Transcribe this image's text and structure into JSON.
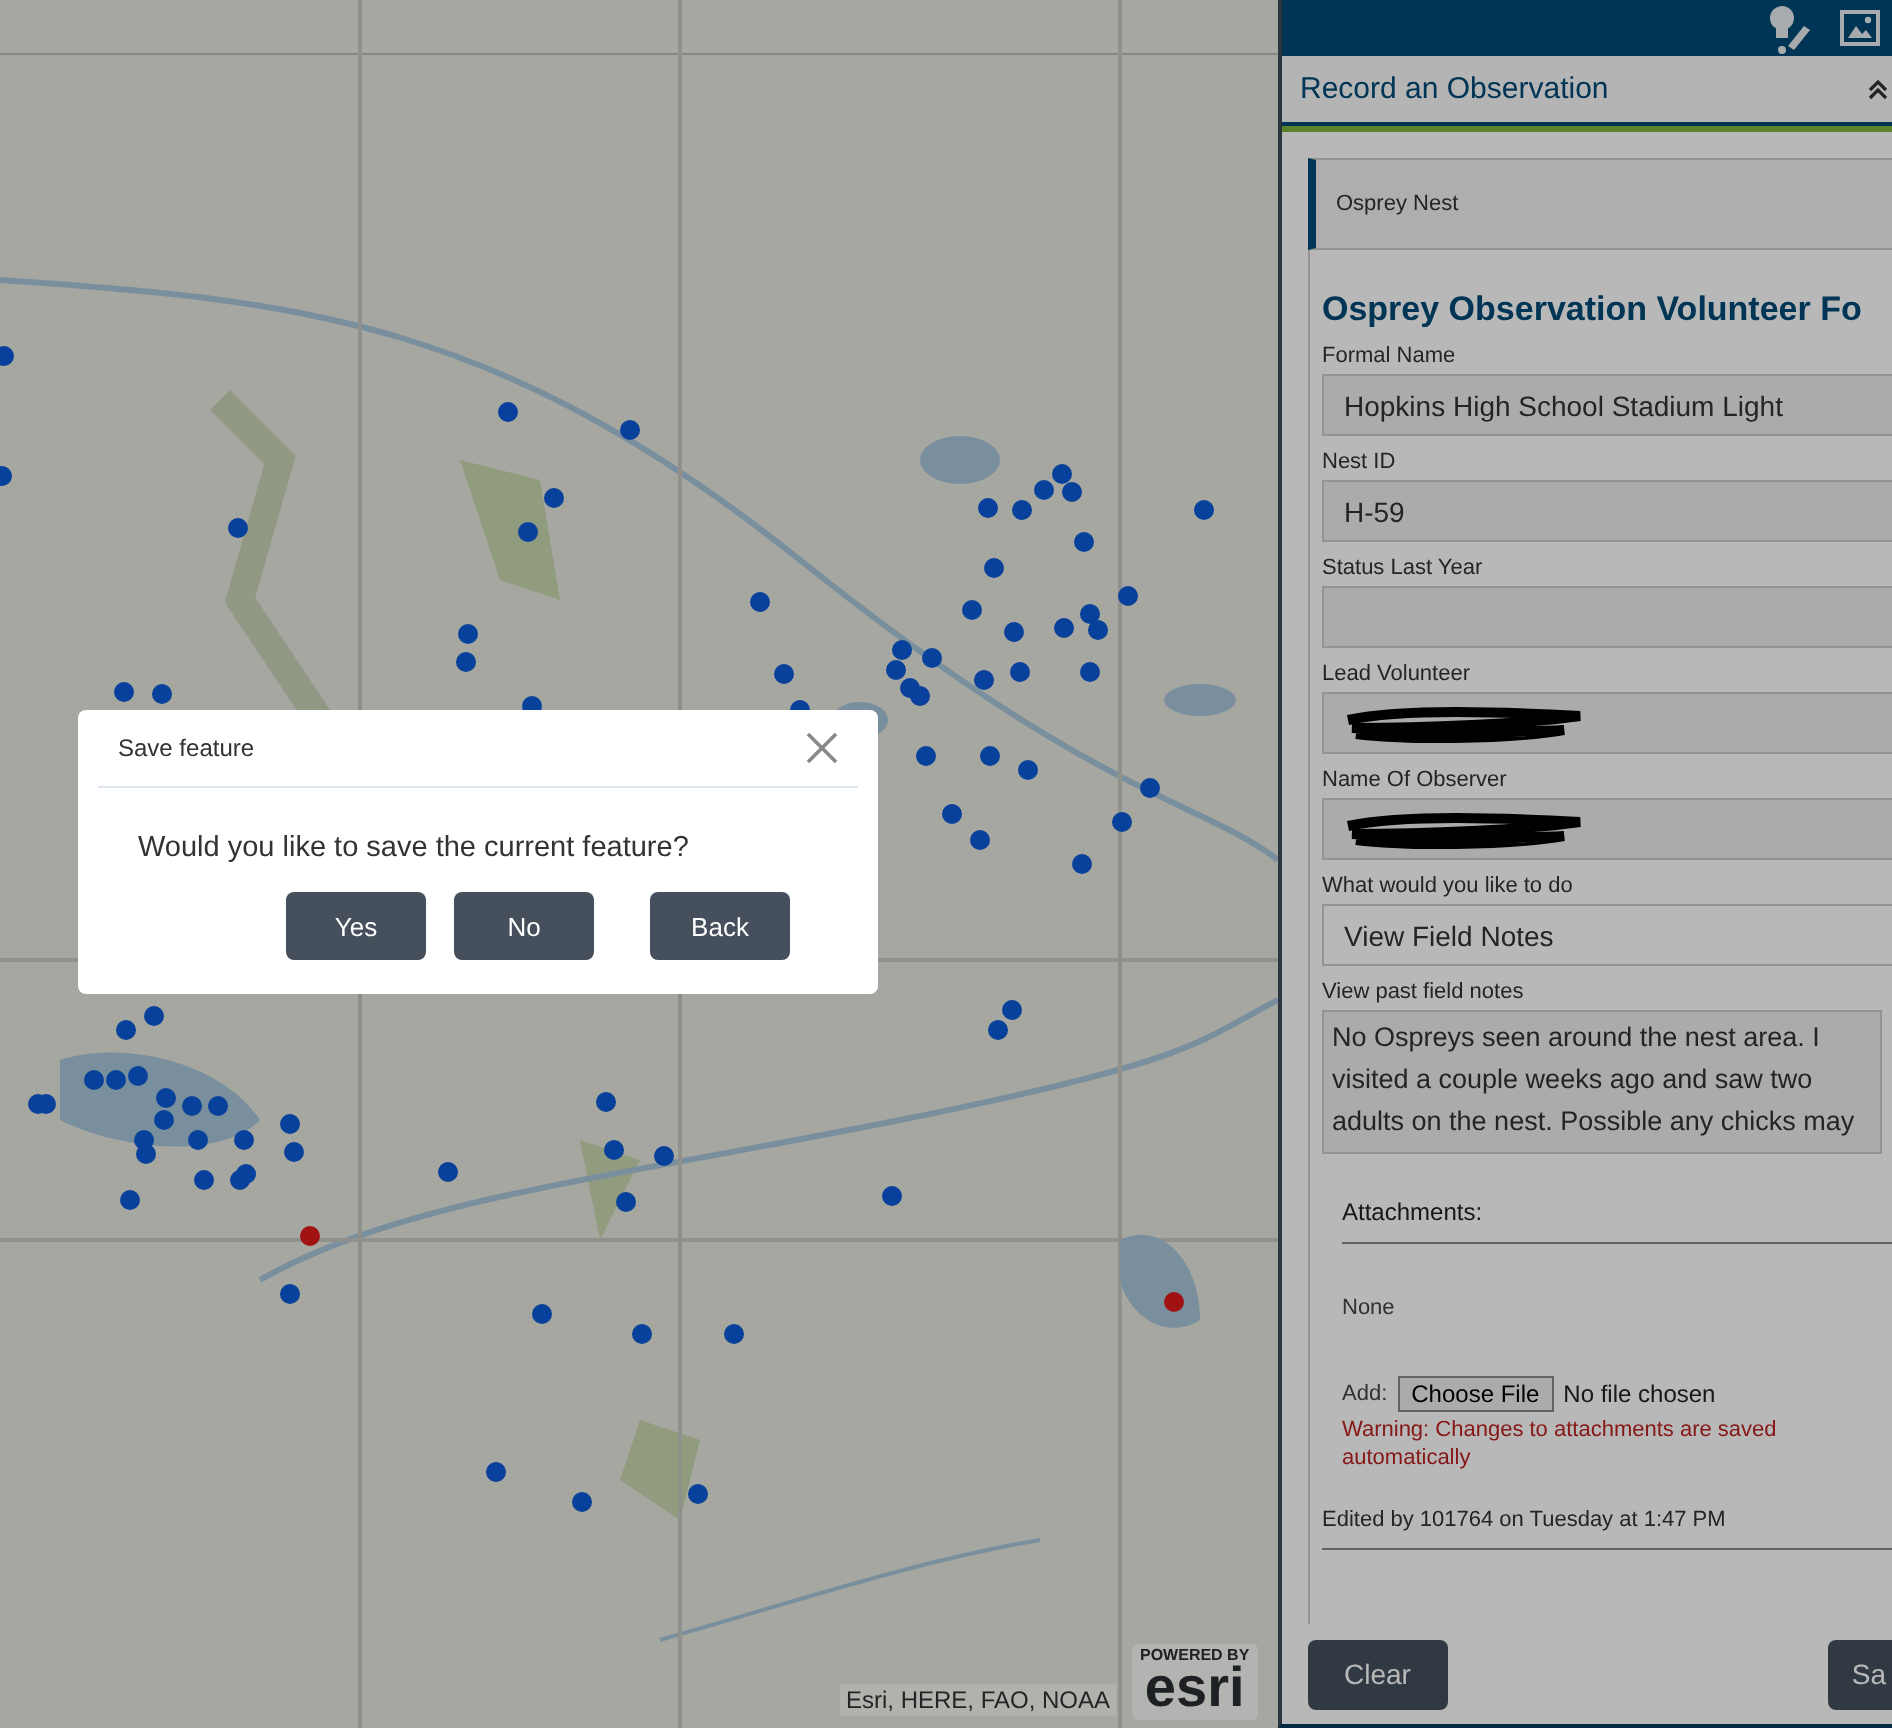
{
  "map": {
    "attribution": "Esri, HERE, FAO, NOAA",
    "logo": {
      "tagline": "POWERED BY",
      "name": "esri"
    }
  },
  "panel": {
    "title": "Record an Observation",
    "template": "Osprey Nest",
    "form_title": "Osprey Observation Volunteer Fo",
    "fields": [
      {
        "label": "Formal Name",
        "value": "Hopkins High School Stadium Light",
        "kind": "text"
      },
      {
        "label": "Nest ID",
        "value": "H-59",
        "kind": "text"
      },
      {
        "label": "Status Last Year",
        "kind": "empty"
      },
      {
        "label": "Lead Volunteer",
        "kind": "redacted"
      },
      {
        "label": "Name Of Observer",
        "kind": "redacted"
      },
      {
        "label": "What would you like to do",
        "value": "View Field Notes",
        "kind": "select"
      },
      {
        "label": "View past field notes",
        "value": "No Ospreys seen around the nest area. I visited a couple weeks ago and saw two adults on the nest. Possible any chicks may",
        "kind": "textarea"
      }
    ],
    "attachments": {
      "heading": "Attachments:",
      "list": "None",
      "add_label": "Add:",
      "choose_button": "Choose File",
      "file_status": "No file chosen",
      "warning": "Warning: Changes to attachments are saved automatically"
    },
    "edited": "Edited by 101764 on Tuesday at 1:47 PM",
    "buttons": [
      "Clear",
      "Sa"
    ]
  },
  "dialog": {
    "title": "Save feature",
    "message": "Would you like to save the current feature?",
    "buttons": [
      "Yes",
      "No",
      "Back"
    ]
  }
}
